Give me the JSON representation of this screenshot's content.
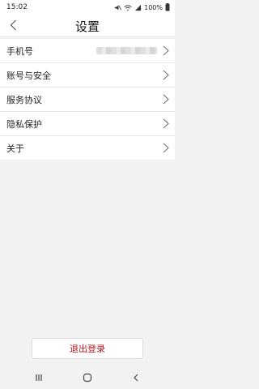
{
  "status_bar": {
    "time": "15:02",
    "battery": "100%",
    "icons": [
      "mute-icon",
      "wifi-icon",
      "signal-icon"
    ]
  },
  "header": {
    "title": "设置",
    "back_icon": "chevron-left-icon"
  },
  "settings": {
    "items": [
      {
        "label": "手机号",
        "value_blurred": true
      },
      {
        "label": "账号与安全"
      },
      {
        "label": "服务协议"
      },
      {
        "label": "隐私保护"
      },
      {
        "label": "关于"
      }
    ]
  },
  "logout": {
    "label": "退出登录",
    "color": "#c0151b"
  },
  "nav": {
    "icons": [
      "recents-icon",
      "home-icon",
      "back-icon"
    ]
  }
}
